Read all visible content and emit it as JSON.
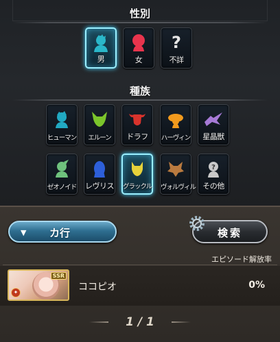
{
  "gender": {
    "title": "性別",
    "items": [
      {
        "label": "男",
        "icon": "male-silhouette-icon",
        "color": "#2ab7c9",
        "selected": true
      },
      {
        "label": "女",
        "icon": "female-silhouette-icon",
        "color": "#e8344d",
        "selected": false
      },
      {
        "label": "不詳",
        "icon": "question-mark-icon",
        "color": "#e6e6e6",
        "selected": false
      }
    ]
  },
  "race": {
    "title": "種族",
    "items": [
      {
        "label": "ヒューマン",
        "icon": "human-icon",
        "color": "#21a9c2",
        "selected": false
      },
      {
        "label": "エルーン",
        "icon": "erune-icon",
        "color": "#7bc52b",
        "selected": false
      },
      {
        "label": "ドラフ",
        "icon": "draph-icon",
        "color": "#d8332c",
        "selected": false
      },
      {
        "label": "ハーヴィン",
        "icon": "harvin-icon",
        "color": "#f29a1d",
        "selected": false
      },
      {
        "label": "星晶獣",
        "icon": "primal-beast-icon",
        "color": "#a67ad6",
        "selected": false
      },
      {
        "label": "ゼオノイド",
        "icon": "xenoid-icon",
        "color": "#6fc27d",
        "selected": false
      },
      {
        "label": "レヴリス",
        "icon": "revris-icon",
        "color": "#2d5fd9",
        "selected": false
      },
      {
        "label": "グラックル",
        "icon": "grackle-icon",
        "color": "#e6d23a",
        "selected": true
      },
      {
        "label": "ヴォルヴィル",
        "icon": "volvil-icon",
        "color": "#b97a3f",
        "selected": false
      },
      {
        "label": "その他",
        "icon": "other-icon",
        "color": "#c9c9c9",
        "selected": false
      }
    ]
  },
  "controls": {
    "row_select": "カ行",
    "row_select_icon": "triangle-down-icon",
    "search": "検索",
    "search_icon": "gear-icon"
  },
  "results": {
    "column_header": "エピソード解放率",
    "entries": [
      {
        "name": "ココピオ",
        "rate": "0%",
        "rarity": "SSR"
      }
    ],
    "page": "1 / 1"
  },
  "colors": {
    "selected_glow": "#47d3ff",
    "panel": "#2e2a26"
  }
}
